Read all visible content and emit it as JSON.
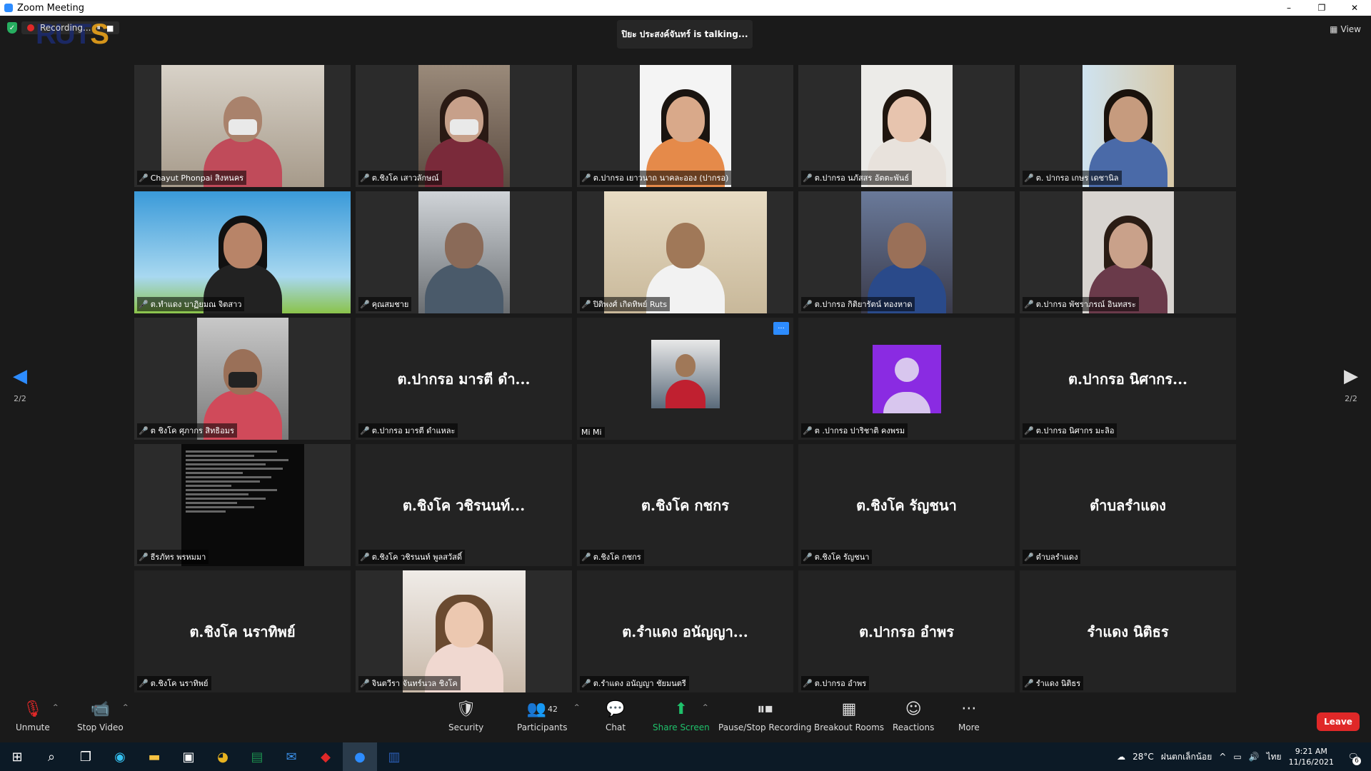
{
  "window": {
    "title": "Zoom Meeting",
    "minimize": "–",
    "restore": "❐",
    "close": "✕"
  },
  "top": {
    "recording_label": "Recording...",
    "pause_icon": "⏸",
    "stop_icon": "■",
    "logo_text": "RUT",
    "logo_s": "S",
    "talking": "ปิยะ ประสงค์จันทร์ is talking...",
    "view_label": "View",
    "view_icon": "▦"
  },
  "nav": {
    "left_arrow": "◀",
    "right_arrow": "▶",
    "page_left": "2/2",
    "page_right": "2/2"
  },
  "participants": [
    {
      "label": "Chayut Phonpai สิงหนคร",
      "muted": true
    },
    {
      "label": "ต.ชิงโค เสาวลักษณ์",
      "muted": true
    },
    {
      "label": "ต.ปากรอ เยาวนาถ นาคละออง (ปากรอ)",
      "muted": true
    },
    {
      "label": "ต.ปากรอ นภัสสร อัตตะพันธ์",
      "muted": true
    },
    {
      "label": "ต. ปากรอ เกษร เดชานิล",
      "muted": true
    },
    {
      "label": "ต.ทำแดง บาฏิยมณ จิตสาว",
      "muted": true
    },
    {
      "label": "คุณสมชาย",
      "muted": true
    },
    {
      "label": "ปิติพงศ์ เกิดทิพย์ Ruts",
      "muted": true
    },
    {
      "label": "ต.ปากรอ กิติยารัตน์ ทองหาด",
      "muted": true
    },
    {
      "label": "ต.ปากรอ พัชราภรณ์ อินทสระ",
      "muted": true
    },
    {
      "label": "ต ชิงโค ศุภากร สิทธิอมร",
      "muted": true
    },
    {
      "label": "ต.ปากรอ มารตี ดำแหละ",
      "muted": true,
      "display": "ต.ปากรอ มารตี ดำ..."
    },
    {
      "label": "Mi Mi",
      "muted": false,
      "more": "···"
    },
    {
      "label": "ต .ปากรอ ปาริชาติ คงพรม",
      "muted": true
    },
    {
      "label": "ต.ปากรอ นิศากร มะลิอ",
      "muted": true,
      "display": "ต.ปากรอ นิศากร..."
    },
    {
      "label": "ธีรภัทร พรหมมา",
      "muted": true
    },
    {
      "label": "ต.ชิงโค วชิรนนท์ พูลสวัสดิ์",
      "muted": true,
      "display": "ต.ชิงโค วชิรนนท์..."
    },
    {
      "label": "ต.ชิงโค กชกร",
      "muted": true,
      "display": "ต.ชิงโค กชกร"
    },
    {
      "label": "ต.ชิงโค รัญชนา",
      "muted": true,
      "display": "ต.ชิงโค รัญชนา"
    },
    {
      "label": "ตำบลรำแดง",
      "muted": true,
      "display": "ตำบลรำแดง"
    },
    {
      "label": "ต.ชิงโค นราทิพย์",
      "muted": true,
      "display": "ต.ชิงโค นราทิพย์"
    },
    {
      "label": "จินตวีรา จันทร์นวล ชิงโค",
      "muted": true
    },
    {
      "label": "ต.รำแดง อนัญญา ชัยมนตรี",
      "muted": true,
      "display": "ต.รำแดง อนัญญา..."
    },
    {
      "label": "ต.ปากรอ อำพร",
      "muted": true,
      "display": "ต.ปากรอ อำพร"
    },
    {
      "label": "รำแดง นิติธร",
      "muted": true,
      "display": "รำแดง นิติธร"
    }
  ],
  "toolbar": {
    "unmute": "Unmute",
    "stop_video": "Stop Video",
    "security": "Security",
    "participants": "Participants",
    "participant_count": "42",
    "chat": "Chat",
    "share_screen": "Share Screen",
    "pause_recording": "Pause/Stop Recording",
    "breakout_rooms": "Breakout Rooms",
    "reactions": "Reactions",
    "more": "More",
    "leave": "Leave",
    "caret": "^"
  },
  "taskbar": {
    "weather": "28°C",
    "weather_text": "ฝนตกเล็กน้อย",
    "lang": "ไทย",
    "time": "9:21 AM",
    "date": "11/16/2021",
    "notif_count": "6",
    "tray_caret": "^"
  },
  "colors": {
    "accent": "#2d8cff",
    "leave": "#e02828",
    "share": "#1fc16b",
    "muted_mic": "#e02828"
  }
}
